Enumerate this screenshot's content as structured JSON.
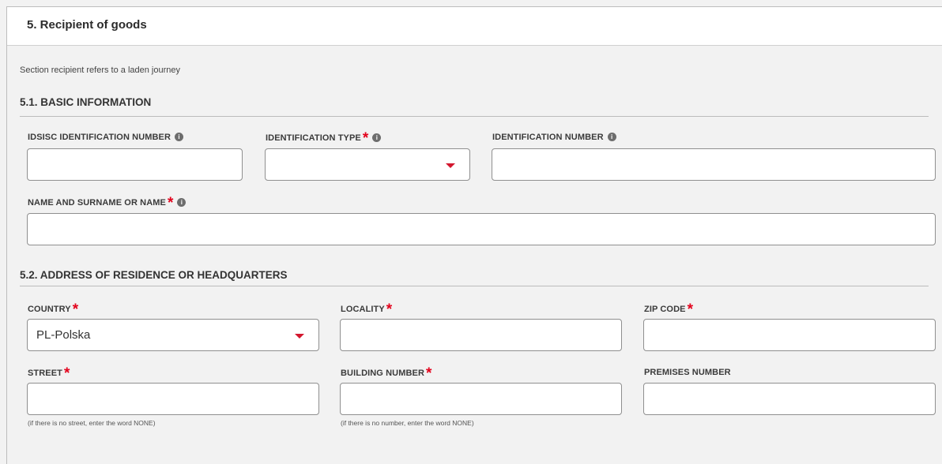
{
  "header": {
    "title": "5. Recipient of goods"
  },
  "note": "Section recipient refers to a laden journey",
  "basic": {
    "title": "5.1. BASIC INFORMATION",
    "idsisc_label": "IDSISC IDENTIFICATION NUMBER",
    "idsisc_value": "",
    "id_type_label": "IDENTIFICATION TYPE",
    "id_type_value": "",
    "id_number_label": "IDENTIFICATION NUMBER",
    "id_number_value": "",
    "name_label": "NAME AND SURNAME OR NAME",
    "name_value": ""
  },
  "address": {
    "title": "5.2. ADDRESS OF RESIDENCE OR HEADQUARTERS",
    "country_label": "COUNTRY",
    "country_value": "PL-Polska",
    "locality_label": "LOCALITY",
    "locality_value": "",
    "zip_label": "ZIP CODE",
    "zip_value": "",
    "street_label": "STREET",
    "street_value": "",
    "street_hint": "(if there is no street, enter the word NONE)",
    "building_label": "BUILDING NUMBER",
    "building_value": "",
    "building_hint": "(if there is no number, enter the word NONE)",
    "premises_label": "PREMISES NUMBER",
    "premises_value": ""
  },
  "required_mark": "*",
  "info_glyph": "i",
  "icons": {
    "required": "asterisk-icon",
    "info": "info-circle-icon",
    "dropdown": "caret-down-icon"
  },
  "colors": {
    "required": "#e3001b",
    "caret": "#d3172e",
    "info": "#6d6d6d",
    "background": "#f2f2f2"
  }
}
